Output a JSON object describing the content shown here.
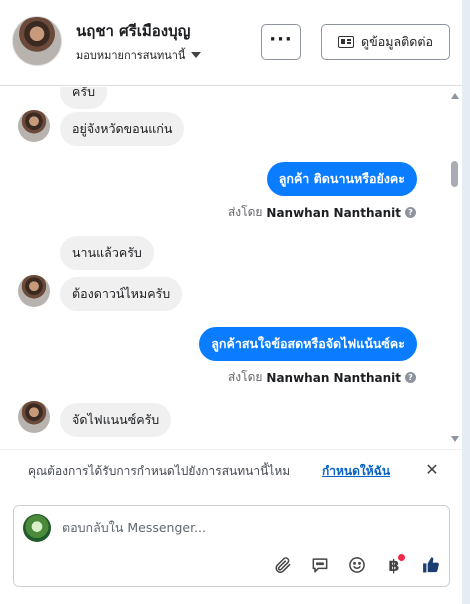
{
  "header": {
    "contact_name": "นฤชา ศรีเมืองบุญ",
    "assign_label": "มอบหมายการสนทนานี้",
    "more_label": "···",
    "contact_info_label": "ดูข้อมูลติดต่อ"
  },
  "thread": {
    "messages": [
      {
        "direction": "in",
        "text": "ครับ",
        "avatar": false
      },
      {
        "direction": "in",
        "text": "อยู่จังหวัดขอนแก่น",
        "avatar": true
      },
      {
        "direction": "out",
        "text": "ลูกค้า ติดนานหรือยังคะ"
      },
      {
        "direction": "in",
        "text": "นานแล้วครับ",
        "avatar": false
      },
      {
        "direction": "in",
        "text": "ต้องดาวน์ไหมครับ",
        "avatar": true
      },
      {
        "direction": "out",
        "text": "ลูกค้าสนใจข้อสดหรือจัดไฟแน้นซ์คะ"
      },
      {
        "direction": "in",
        "text": "จัดไฟแนนซ์ครับ",
        "avatar": true
      }
    ],
    "sent_by_prefix": "ส่งโดย",
    "sent_by_name": "Nanwhan Nanthanit"
  },
  "followup": {
    "question": "คุณต้องการได้รับการกำหนดไปยังการสนทนานี้ไหม",
    "action": "กำหนดให้ฉัน",
    "close": "✕"
  },
  "composer": {
    "placeholder": "ตอบกลับใน Messenger...",
    "value": "",
    "tools": [
      "paperclip-icon",
      "chat-bubble-icon",
      "emoji-icon",
      "baht-icon",
      "thumbs-up-icon"
    ],
    "baht_symbol": "฿",
    "accent_color": "#0a7cff",
    "like_color": "#1c3f72",
    "notification_dot_color": "#f0284a"
  }
}
